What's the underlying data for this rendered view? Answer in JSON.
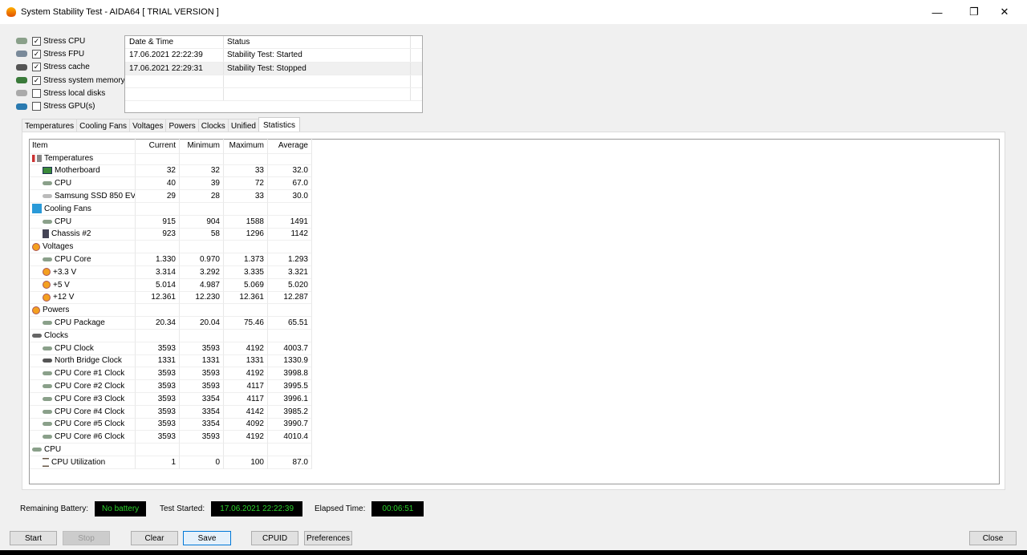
{
  "window": {
    "title": "System Stability Test - AIDA64  [ TRIAL VERSION ]"
  },
  "stress": [
    {
      "label": "Stress CPU",
      "checked": true
    },
    {
      "label": "Stress FPU",
      "checked": true
    },
    {
      "label": "Stress cache",
      "checked": true
    },
    {
      "label": "Stress system memory",
      "checked": true
    },
    {
      "label": "Stress local disks",
      "checked": false
    },
    {
      "label": "Stress GPU(s)",
      "checked": false
    }
  ],
  "log": {
    "headers": [
      "Date & Time",
      "Status"
    ],
    "rows": [
      [
        "17.06.2021 22:22:39",
        "Stability Test: Started"
      ],
      [
        "17.06.2021 22:29:31",
        "Stability Test: Stopped"
      ],
      [
        "",
        ""
      ],
      [
        "",
        ""
      ]
    ]
  },
  "tabs": [
    "Temperatures",
    "Cooling Fans",
    "Voltages",
    "Powers",
    "Clocks",
    "Unified",
    "Statistics"
  ],
  "stats": {
    "headers": [
      "Item",
      "Current",
      "Minimum",
      "Maximum",
      "Average"
    ],
    "rows": [
      {
        "g": 1,
        "icon": "thermometer-icon",
        "v": [
          "Temperatures",
          "",
          "",
          "",
          ""
        ]
      },
      {
        "g": 0,
        "icon": "motherboard-icon",
        "v": [
          "Motherboard",
          "32",
          "32",
          "33",
          "32.0"
        ]
      },
      {
        "g": 0,
        "icon": "cpu-icon",
        "v": [
          "CPU",
          "40",
          "39",
          "72",
          "67.0"
        ]
      },
      {
        "g": 0,
        "icon": "disk-icon",
        "v": [
          "Samsung SSD 850 EV...",
          "29",
          "28",
          "33",
          "30.0"
        ]
      },
      {
        "g": 1,
        "icon": "fan-icon",
        "v": [
          "Cooling Fans",
          "",
          "",
          "",
          ""
        ]
      },
      {
        "g": 0,
        "icon": "cpu-icon",
        "v": [
          "CPU",
          "915",
          "904",
          "1588",
          "1491"
        ]
      },
      {
        "g": 0,
        "icon": "chassis-icon",
        "v": [
          "Chassis #2",
          "923",
          "58",
          "1296",
          "1142"
        ]
      },
      {
        "g": 1,
        "icon": "voltage-icon",
        "v": [
          "Voltages",
          "",
          "",
          "",
          ""
        ]
      },
      {
        "g": 0,
        "icon": "cpu-icon",
        "v": [
          "CPU Core",
          "1.330",
          "0.970",
          "1.373",
          "1.293"
        ]
      },
      {
        "g": 0,
        "icon": "voltage-icon",
        "v": [
          "+3.3 V",
          "3.314",
          "3.292",
          "3.335",
          "3.321"
        ]
      },
      {
        "g": 0,
        "icon": "voltage-icon",
        "v": [
          "+5 V",
          "5.014",
          "4.987",
          "5.069",
          "5.020"
        ]
      },
      {
        "g": 0,
        "icon": "voltage-icon",
        "v": [
          "+12 V",
          "12.361",
          "12.230",
          "12.361",
          "12.287"
        ]
      },
      {
        "g": 1,
        "icon": "power-icon",
        "v": [
          "Powers",
          "",
          "",
          "",
          ""
        ]
      },
      {
        "g": 0,
        "icon": "cpu-icon",
        "v": [
          "CPU Package",
          "20.34",
          "20.04",
          "75.46",
          "65.51"
        ]
      },
      {
        "g": 1,
        "icon": "clock-icon",
        "v": [
          "Clocks",
          "",
          "",
          "",
          ""
        ]
      },
      {
        "g": 0,
        "icon": "cpu-icon",
        "v": [
          "CPU Clock",
          "3593",
          "3593",
          "4192",
          "4003.7"
        ]
      },
      {
        "g": 0,
        "icon": "chip-icon",
        "v": [
          "North Bridge Clock",
          "1331",
          "1331",
          "1331",
          "1330.9"
        ]
      },
      {
        "g": 0,
        "icon": "cpu-icon",
        "v": [
          "CPU Core #1 Clock",
          "3593",
          "3593",
          "4192",
          "3998.8"
        ]
      },
      {
        "g": 0,
        "icon": "cpu-icon",
        "v": [
          "CPU Core #2 Clock",
          "3593",
          "3593",
          "4117",
          "3995.5"
        ]
      },
      {
        "g": 0,
        "icon": "cpu-icon",
        "v": [
          "CPU Core #3 Clock",
          "3593",
          "3354",
          "4117",
          "3996.1"
        ]
      },
      {
        "g": 0,
        "icon": "cpu-icon",
        "v": [
          "CPU Core #4 Clock",
          "3593",
          "3354",
          "4142",
          "3985.2"
        ]
      },
      {
        "g": 0,
        "icon": "cpu-icon",
        "v": [
          "CPU Core #5 Clock",
          "3593",
          "3354",
          "4092",
          "3990.7"
        ]
      },
      {
        "g": 0,
        "icon": "cpu-icon",
        "v": [
          "CPU Core #6 Clock",
          "3593",
          "3593",
          "4192",
          "4010.4"
        ]
      },
      {
        "g": 1,
        "icon": "cpu-icon",
        "v": [
          "CPU",
          "",
          "",
          "",
          ""
        ]
      },
      {
        "g": 0,
        "icon": "hourglass-icon",
        "v": [
          "CPU Utilization",
          "1",
          "0",
          "100",
          "87.0"
        ]
      }
    ]
  },
  "status": {
    "battery_label": "Remaining Battery:",
    "battery": "No battery",
    "started_label": "Test Started:",
    "started": "17.06.2021 22:22:39",
    "elapsed_label": "Elapsed Time:",
    "elapsed": "00:06:51"
  },
  "buttons": {
    "start": "Start",
    "stop": "Stop",
    "clear": "Clear",
    "save": "Save",
    "cpuid": "CPUID",
    "preferences": "Preferences",
    "close": "Close"
  },
  "colors": {
    "led_text": "#2bd02b",
    "led_bg": "#000000"
  }
}
